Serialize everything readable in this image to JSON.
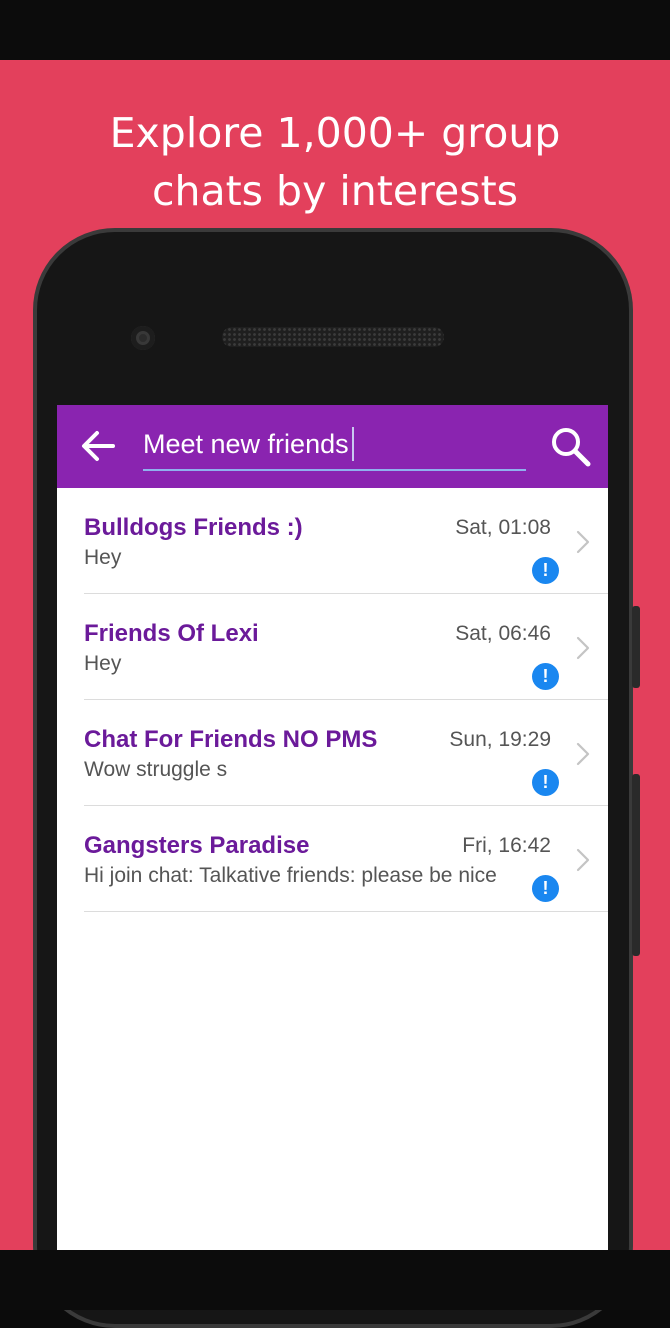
{
  "promo": {
    "headline_line1": "Explore 1,000+ group",
    "headline_line2": "chats by interests"
  },
  "app_bar": {
    "search_value": "Meet new friends",
    "back_icon": "arrow-left-icon",
    "search_icon": "search-icon"
  },
  "chats": [
    {
      "title": "Bulldogs Friends :)",
      "preview": "Hey",
      "time": "Sat, 01:08",
      "badge": "!"
    },
    {
      "title": "Friends Of Lexi",
      "preview": "Hey",
      "time": "Sat, 06:46",
      "badge": "!"
    },
    {
      "title": "Chat For Friends NO PMS",
      "preview": "Wow struggle s",
      "time": "Sun, 19:29",
      "badge": "!"
    },
    {
      "title": "Gangsters Paradise",
      "preview": "Hi join chat: Talkative friends: please be nice",
      "time": "Fri, 16:42",
      "badge": "!"
    }
  ],
  "colors": {
    "promo_background": "#e3405c",
    "app_bar": "#8a24b0",
    "chat_title": "#6b1a9a",
    "unread_badge": "#1a87f0"
  }
}
